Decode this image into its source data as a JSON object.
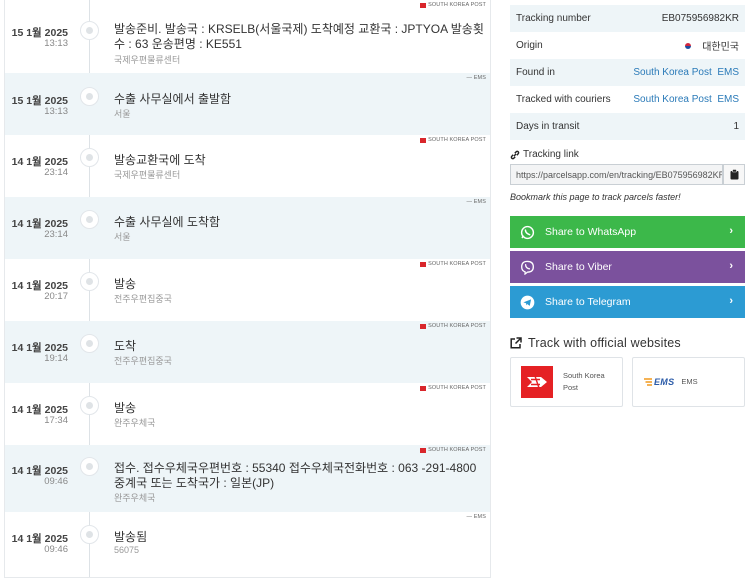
{
  "events": [
    {
      "date": "15 1월 2025",
      "time": "13:13",
      "desc": "발송준비. 발송국 : KRSELB(서울국제) 도착예정 교환국 : JPTYOA 발송횟수 : 63 운송편명 : KE551",
      "location": "국제우편물류센터",
      "tag": "SOUTH KOREA POST",
      "flag": true
    },
    {
      "date": "15 1월 2025",
      "time": "13:13",
      "desc": "수출 사무실에서 출발함",
      "location": "서울",
      "tag": "— EMS",
      "flag": false
    },
    {
      "date": "14 1월 2025",
      "time": "23:14",
      "desc": "발송교환국에 도착",
      "location": "국제우편물류센터",
      "tag": "SOUTH KOREA POST",
      "flag": true
    },
    {
      "date": "14 1월 2025",
      "time": "23:14",
      "desc": "수출 사무실에 도착함",
      "location": "서울",
      "tag": "— EMS",
      "flag": false
    },
    {
      "date": "14 1월 2025",
      "time": "20:17",
      "desc": "발송",
      "location": "전주우편집중국",
      "tag": "SOUTH KOREA POST",
      "flag": true
    },
    {
      "date": "14 1월 2025",
      "time": "19:14",
      "desc": "도착",
      "location": "전주우편집중국",
      "tag": "SOUTH KOREA POST",
      "flag": true
    },
    {
      "date": "14 1월 2025",
      "time": "17:34",
      "desc": "발송",
      "location": "완주우체국",
      "tag": "SOUTH KOREA POST",
      "flag": true
    },
    {
      "date": "14 1월 2025",
      "time": "09:46",
      "desc": "접수. 접수우체국우편번호 : 55340 접수우체국전화번호 : 063 -291-4800 중계국 또는 도착국가 : 일본(JP)",
      "location": "완주우체국",
      "tag": "SOUTH KOREA POST",
      "flag": true
    },
    {
      "date": "14 1월 2025",
      "time": "09:46",
      "desc": "발송됨",
      "location": "56075",
      "tag": "— EMS",
      "flag": false
    }
  ],
  "info": {
    "tracking_number_label": "Tracking number",
    "tracking_number": "EB075956982KR",
    "origin_label": "Origin",
    "origin": "대한민국",
    "found_in_label": "Found in",
    "found_in_1": "South Korea Post",
    "found_in_2": "EMS",
    "tracked_label": "Tracked with couriers",
    "tracked_1": "South Korea Post",
    "tracked_2": "EMS",
    "days_label": "Days in transit",
    "days": "1"
  },
  "tracking_link": {
    "label": "Tracking link",
    "url": "https://parcelsapp.com/en/tracking/EB075956982KR",
    "bookmark_hint": "Bookmark this page to track parcels faster!"
  },
  "share": {
    "whatsapp": "Share to WhatsApp",
    "viber": "Share to Viber",
    "telegram": "Share to Telegram",
    "chevron": "›"
  },
  "official": {
    "title": "Track with official websites",
    "card1_name_line1": "South Korea",
    "card1_name_line2": "Post",
    "card2_logo": "EMS",
    "card2_name": "EMS"
  },
  "colors": {
    "whatsapp": "#3cb84a",
    "viber": "#7b519d",
    "telegram": "#2c9bd3",
    "korea_post_red": "#e52124",
    "ems_blue": "#2b5ba8",
    "ems_orange": "#f29a1f",
    "link_blue": "#2a7ab8"
  }
}
